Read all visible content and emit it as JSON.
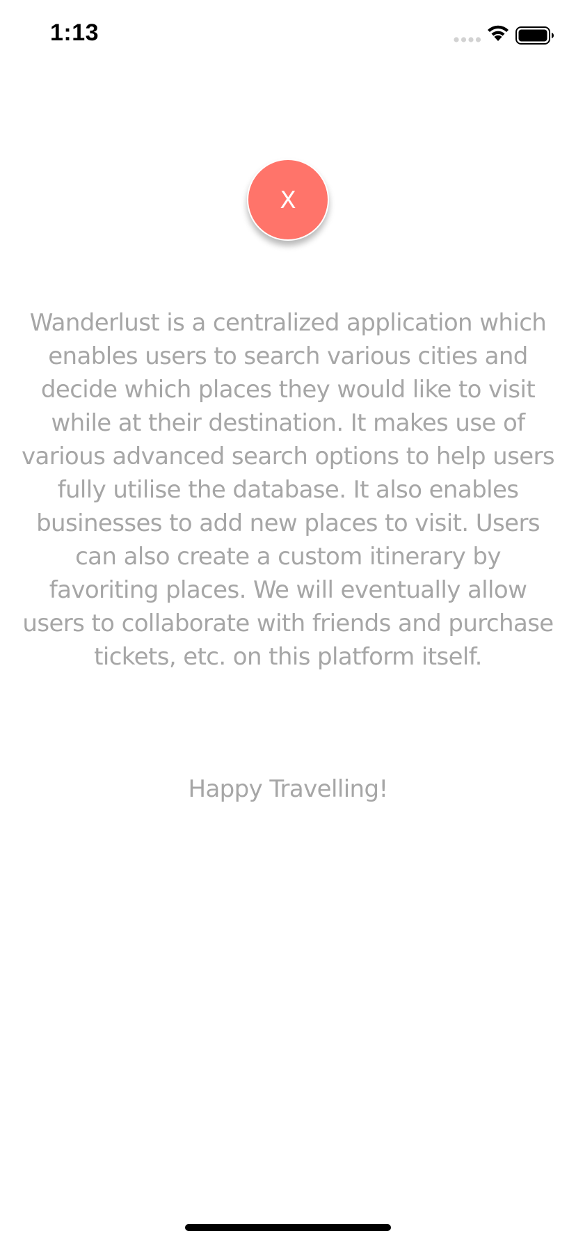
{
  "status_bar": {
    "time": "1:13",
    "signal_icon": "cellular-signal-icon",
    "wifi_icon": "wifi-icon",
    "battery_icon": "battery-icon"
  },
  "close_button": {
    "label": "X",
    "color": "#ff746a"
  },
  "about": {
    "description": "Wanderlust is a centralized application which enables users to search various cities and decide which places they would like to visit while at their destination. It makes use of various advanced search options to help users fully utilise the database. It also enables businesses to add new places to visit. Users can also create a custom itinerary by favoriting places. We will eventually allow users to collaborate with friends and purchase tickets, etc. on this platform itself.",
    "closing": "Happy Travelling!",
    "text_color": "#a6a6a6"
  }
}
